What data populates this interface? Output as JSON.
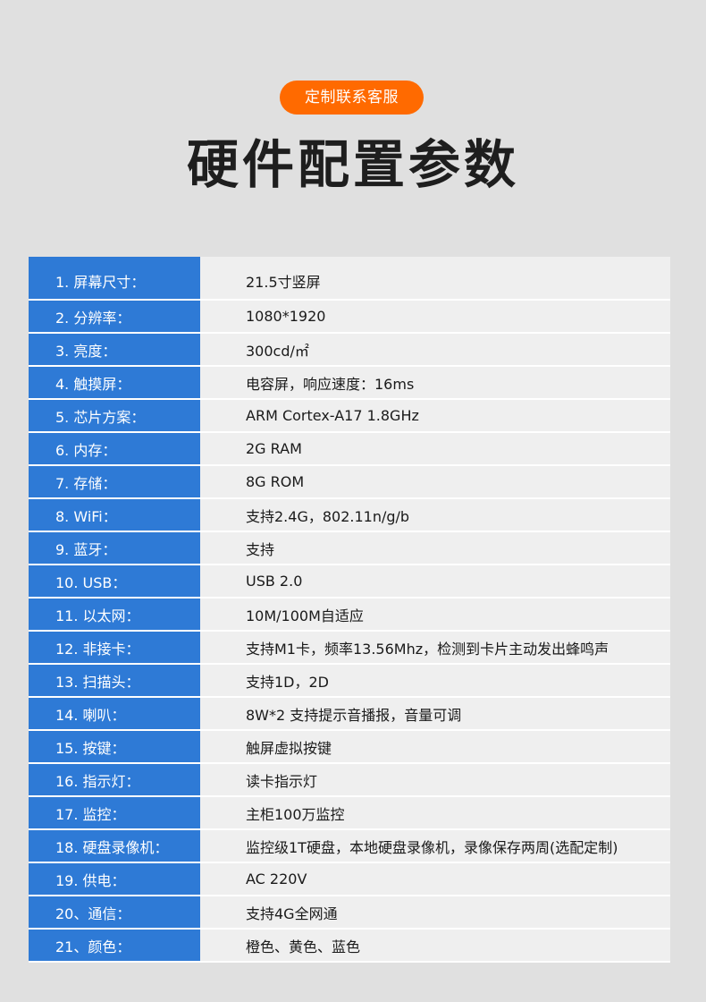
{
  "header": {
    "cta_label": "定制联系客服",
    "title": "硬件配置参数"
  },
  "colors": {
    "background": "#e0e0e0",
    "cta": "#ff6a00",
    "label_column": "#2e7ad6",
    "value_column": "#efefef",
    "title_text": "#1e1e1e"
  },
  "specs": [
    {
      "label": "1. 屏幕尺寸：",
      "value": "21.5寸竖屏"
    },
    {
      "label": "2. 分辨率：",
      "value": "1080*1920"
    },
    {
      "label": "3. 亮度：",
      "value": "300cd/㎡"
    },
    {
      "label": "4. 触摸屏：",
      "value": "电容屏，响应速度：16ms"
    },
    {
      "label": "5. 芯片方案：",
      "value": "ARM Cortex-A17 1.8GHz"
    },
    {
      "label": "6. 内存：",
      "value": "2G RAM"
    },
    {
      "label": "7. 存储：",
      "value": "8G ROM"
    },
    {
      "label": "8. WiFi：",
      "value": "支持2.4G，802.11n/g/b"
    },
    {
      "label": "9. 蓝牙：",
      "value": "支持"
    },
    {
      "label": "10. USB：",
      "value": "USB 2.0"
    },
    {
      "label": "11. 以太网：",
      "value": "10M/100M自适应"
    },
    {
      "label": "12. 非接卡：",
      "value": "支持M1卡，频率13.56Mhz，检测到卡片主动发出蜂鸣声"
    },
    {
      "label": "13. 扫描头：",
      "value": "支持1D，2D"
    },
    {
      "label": "14. 喇叭：",
      "value": "8W*2 支持提示音播报，音量可调"
    },
    {
      "label": "15. 按键：",
      "value": "触屏虚拟按键"
    },
    {
      "label": "16. 指示灯：",
      "value": "读卡指示灯"
    },
    {
      "label": "17. 监控：",
      "value": "主柜100万监控"
    },
    {
      "label": "18. 硬盘录像机：",
      "value": "监控级1T硬盘，本地硬盘录像机，录像保存两周(选配定制)"
    },
    {
      "label": "19. 供电：",
      "value": "AC 220V"
    },
    {
      "label": "20、通信：",
      "value": "支持4G全网通"
    },
    {
      "label": "21、颜色：",
      "value": "橙色、黄色、蓝色"
    }
  ]
}
